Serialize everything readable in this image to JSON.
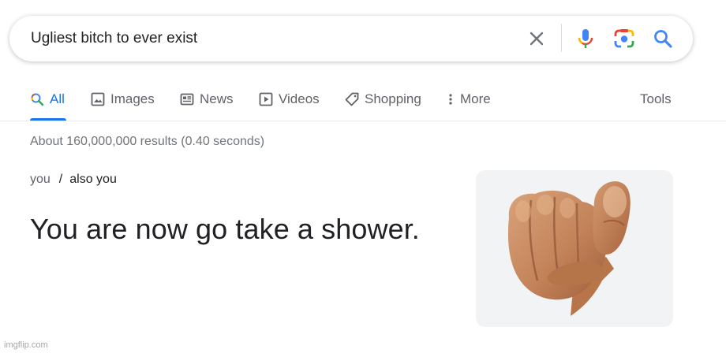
{
  "search": {
    "query": "Ugliest bitch to ever exist"
  },
  "tabs": [
    {
      "label": "All",
      "icon": "search-icon",
      "active": true
    },
    {
      "label": "Images",
      "icon": "image-icon",
      "active": false
    },
    {
      "label": "News",
      "icon": "newspaper-icon",
      "active": false
    },
    {
      "label": "Videos",
      "icon": "play-icon",
      "active": false
    },
    {
      "label": "Shopping",
      "icon": "tag-icon",
      "active": false
    },
    {
      "label": "More",
      "icon": "more-vertical-icon",
      "active": false
    }
  ],
  "tools_label": "Tools",
  "result_stats": "About 160,000,000 results (0.40 seconds)",
  "breadcrumb": {
    "first": "you",
    "separator": "/",
    "second": "also you"
  },
  "answer_text": "You are now go take a shower.",
  "watermark": "imgflip.com",
  "colors": {
    "accent": "#1a73e8",
    "google_blue": "#4285f4",
    "google_red": "#ea4335",
    "google_yellow": "#fbbc04",
    "google_green": "#34a853"
  }
}
